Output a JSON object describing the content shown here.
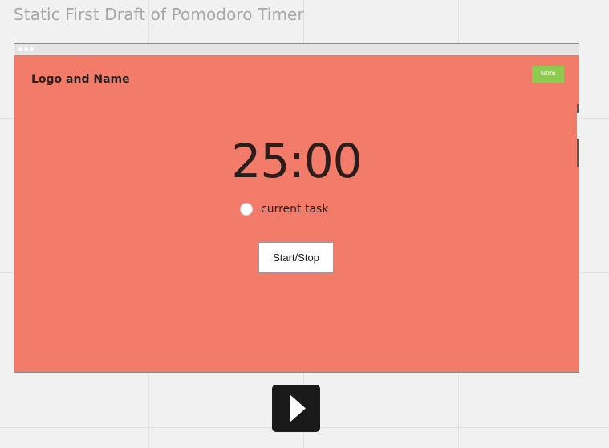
{
  "board": {
    "title": "Static First Draft of Pomodoro Timer"
  },
  "mockup": {
    "logo_text": "Logo and Name",
    "setting_label": "Setting",
    "timer": "25:00",
    "task_label": "current task",
    "start_stop_label": "Start/Stop",
    "accent_color": "#f27b69",
    "setting_color": "#8ccb4f"
  },
  "controls": {
    "play_icon": "play-icon"
  }
}
